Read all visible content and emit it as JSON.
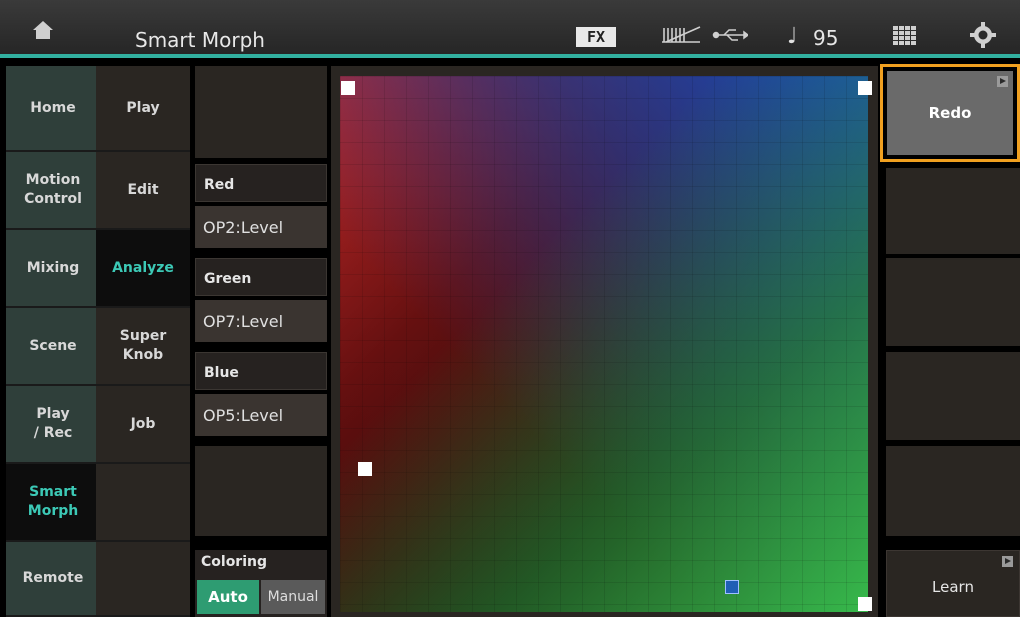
{
  "header": {
    "title": "Smart Morph",
    "fx_label": "FX",
    "tempo": "95",
    "icons": [
      "home-icon",
      "midi-icon",
      "usb-icon",
      "quarter-note-icon",
      "keyboard-grid-icon",
      "gear-icon"
    ]
  },
  "tabs": {
    "col1": [
      {
        "label": "Home"
      },
      {
        "label": "Motion\nControl"
      },
      {
        "label": "Mixing"
      },
      {
        "label": "Scene"
      },
      {
        "label": "Play\n/ Rec"
      },
      {
        "label": "Smart\nMorph",
        "active": true
      },
      {
        "label": "Remote"
      }
    ],
    "col2": [
      {
        "label": "Play"
      },
      {
        "label": "Edit"
      },
      {
        "label": "Analyze",
        "active": true
      },
      {
        "label": "Super\nKnob"
      },
      {
        "label": "Job"
      }
    ]
  },
  "params": {
    "red": {
      "label": "Red",
      "value": "OP2:Level"
    },
    "green": {
      "label": "Green",
      "value": "OP7:Level"
    },
    "blue": {
      "label": "Blue",
      "value": "OP5:Level"
    }
  },
  "coloring": {
    "label": "Coloring",
    "options": [
      "Auto",
      "Manual"
    ],
    "selected": "Auto"
  },
  "right": {
    "redo_label": "Redo",
    "learn_label": "Learn"
  },
  "colors": {
    "accent": "#32b0a0",
    "active_text": "#3cc9b6",
    "focus": "#f0a020",
    "auto_on": "#2e9c72"
  }
}
